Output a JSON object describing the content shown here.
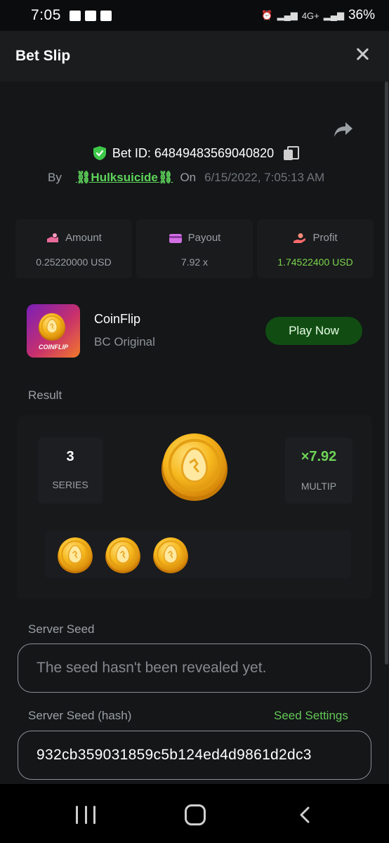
{
  "status_bar": {
    "time": "7:05",
    "network": "4G+",
    "battery": "36%"
  },
  "header": {
    "title": "Bet Slip"
  },
  "bet": {
    "bet_id_label": "Bet ID: 64849483569040820",
    "by_label": "By",
    "username": "⛓Hulksuicide⛓",
    "on_label": "On",
    "date": "6/15/2022, 7:05:13 AM"
  },
  "stats": {
    "amount": {
      "label": "Amount",
      "value": "0.25220000 USD"
    },
    "payout": {
      "label": "Payout",
      "value": "7.92 x"
    },
    "profit": {
      "label": "Profit",
      "value": "1.74522400 USD"
    }
  },
  "game": {
    "name": "CoinFlip",
    "provider": "BC Original",
    "thumb_tag": "COINFLIP",
    "play_button": "Play Now"
  },
  "result": {
    "label": "Result",
    "series_value": "3",
    "series_label": "SERIES",
    "multiplier_value": "×7.92",
    "multiplier_label": "MULTIP",
    "history_coins": 3
  },
  "seeds": {
    "server_seed_label": "Server Seed",
    "server_seed_placeholder": "The seed hasn't been revealed yet.",
    "server_seed_hash_label": "Server Seed (hash)",
    "seed_settings_link": "Seed Settings",
    "server_seed_hash_value": "932cb359031859c5b124ed4d9861d2dc3"
  },
  "colors": {
    "accent_green": "#5ed45a",
    "button_green": "#114d12",
    "background": "#141618",
    "coin_gold": "#f5b820"
  }
}
